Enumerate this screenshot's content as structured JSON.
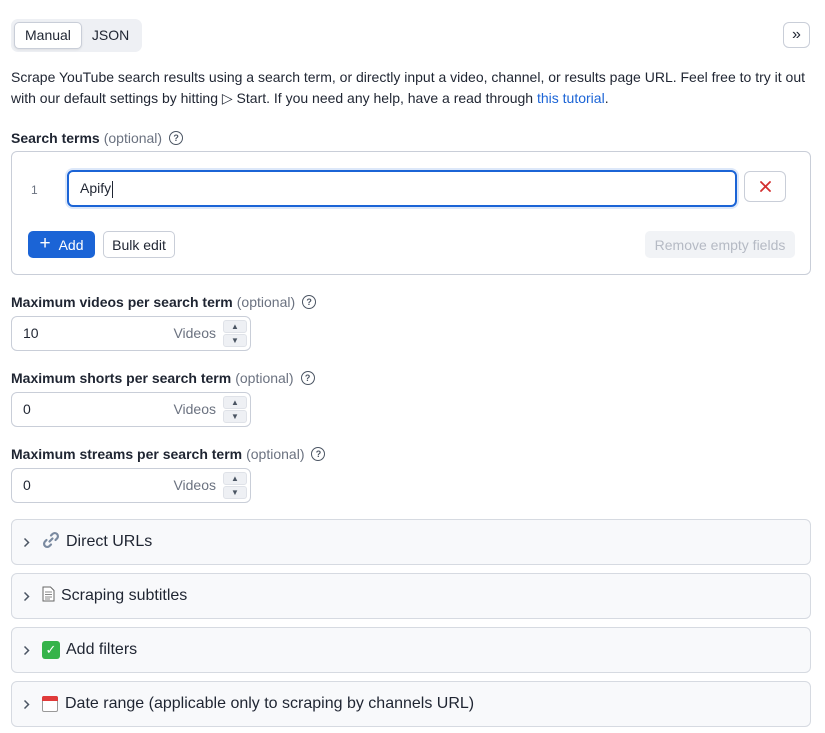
{
  "mode_toggle": {
    "manual": "Manual",
    "json": "JSON"
  },
  "expand_button": "»",
  "description": {
    "text": "Scrape YouTube search results using a search term, or directly input a video, channel, or results page URL. Feel free to try it out with our default settings by hitting ▷ Start. If you need any help, have a read through ",
    "link": "this tutorial",
    "end": "."
  },
  "search_terms": {
    "label": "Search terms",
    "optional": "(optional)",
    "rows": [
      {
        "index": "1",
        "value": "Apify"
      }
    ],
    "add_label": "Add",
    "bulk_edit_label": "Bulk edit",
    "remove_empty_label": "Remove empty fields"
  },
  "max_videos": {
    "label": "Maximum videos per search term",
    "optional": "(optional)",
    "value": "10",
    "unit": "Videos"
  },
  "max_shorts": {
    "label": "Maximum shorts per search term",
    "optional": "(optional)",
    "value": "0",
    "unit": "Videos"
  },
  "max_streams": {
    "label": "Maximum streams per search term",
    "optional": "(optional)",
    "value": "0",
    "unit": "Videos"
  },
  "sections": [
    {
      "icon": "link-icon",
      "label": "Direct URLs"
    },
    {
      "icon": "document-icon",
      "label": "Scraping subtitles"
    },
    {
      "icon": "check-icon",
      "label": "Add filters"
    },
    {
      "icon": "calendar-icon",
      "label": "Date range (applicable only to scraping by channels URL)"
    }
  ]
}
